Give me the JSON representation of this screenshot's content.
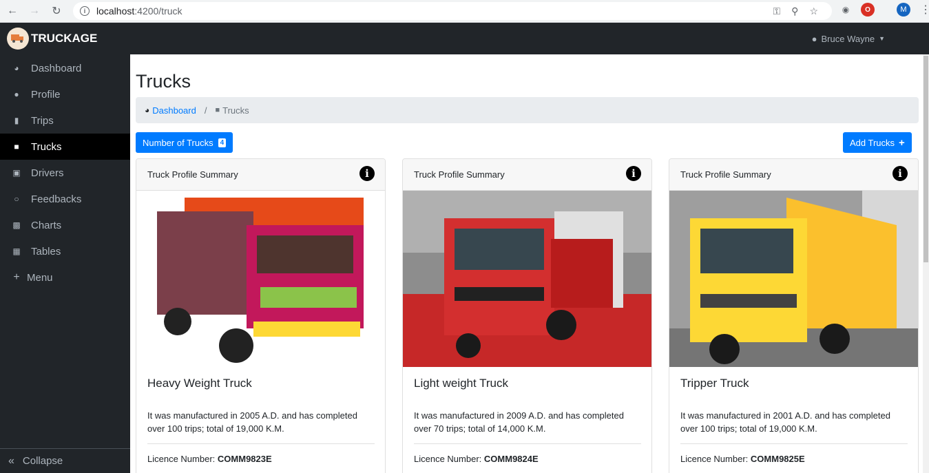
{
  "browser": {
    "url_host": "localhost",
    "url_path": ":4200/truck"
  },
  "navbar": {
    "brand": "TRUCKAGE",
    "user": "Bruce Wayne"
  },
  "sidebar": {
    "items": [
      {
        "label": "Dashboard",
        "icon": "dashboard-icon",
        "active": false
      },
      {
        "label": "Profile",
        "icon": "user-icon",
        "active": false
      },
      {
        "label": "Trips",
        "icon": "book-icon",
        "active": false
      },
      {
        "label": "Trucks",
        "icon": "truck-icon",
        "active": true
      },
      {
        "label": "Drivers",
        "icon": "id-badge-icon",
        "active": false
      },
      {
        "label": "Feedbacks",
        "icon": "comments-icon",
        "active": false
      },
      {
        "label": "Charts",
        "icon": "bar-chart-icon",
        "active": false
      },
      {
        "label": "Tables",
        "icon": "table-icon",
        "active": false
      },
      {
        "label": "Menu",
        "icon": "plus-icon",
        "active": false
      }
    ],
    "collapse_label": "Collapse"
  },
  "main": {
    "title": "Trucks",
    "breadcrumb": {
      "home": "Dashboard",
      "separator": "/",
      "current": "Trucks"
    },
    "count_button": "Number of Trucks",
    "count": "4",
    "add_button": "Add Trucks"
  },
  "cards": [
    {
      "header": "Truck Profile Summary",
      "title": "Heavy Weight Truck",
      "text": "It was manufactured in 2005 A.D. and has completed over 100 trips; total of 19,000 K.M.",
      "licence_label": "Licence Number:",
      "licence": "COMM9823E",
      "body_color": "#c2185b"
    },
    {
      "header": "Truck Profile Summary",
      "title": "Light weight Truck",
      "text": "It was manufactured in 2009 A.D. and has completed over 70 trips; total of 14,000 K.M.",
      "licence_label": "Licence Number:",
      "licence": "COMM9824E",
      "body_color": "#d32f2f"
    },
    {
      "header": "Truck Profile Summary",
      "title": "Tripper Truck",
      "text": "It was manufactured in 2001 A.D. and has completed over 100 trips; total of 19,000 K.M.",
      "licence_label": "Licence Number:",
      "licence": "COMM9825E",
      "body_color": "#fbc02d"
    }
  ],
  "colors": {
    "primary": "#007bff",
    "dark": "#212529",
    "active": "#000000"
  }
}
